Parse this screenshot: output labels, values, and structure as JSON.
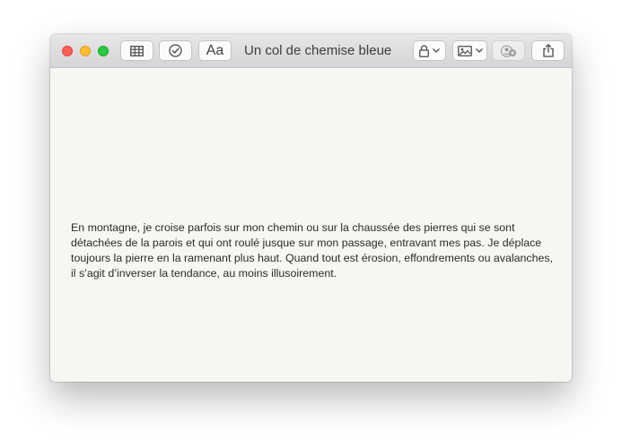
{
  "window": {
    "title": "Un col de chemise bleue"
  },
  "toolbar": {
    "table_icon": "table-icon",
    "checklist_icon": "checklist-icon",
    "format_label": "Aa",
    "lock_icon": "lock-icon",
    "media_icon": "photo-icon",
    "collaborate_icon": "add-people-icon",
    "share_icon": "share-icon",
    "chevron_icon": "chevron-down-icon"
  },
  "note": {
    "body": "En montagne, je croise parfois sur mon chemin ou sur la chaussée des pierres qui se sont détachées de la parois et qui ont roulé jusque sur mon passage, entravant mes pas. Je déplace toujours la pierre en la ramenant plus haut. Quand tout est érosion, effondrements ou avalanches, il s’agit d’inverser la tendance, au moins illusoirement."
  },
  "colors": {
    "close": "#fe5f57",
    "minimize": "#febc2e",
    "maximize": "#28c840",
    "paper": "#f7f6f3"
  }
}
